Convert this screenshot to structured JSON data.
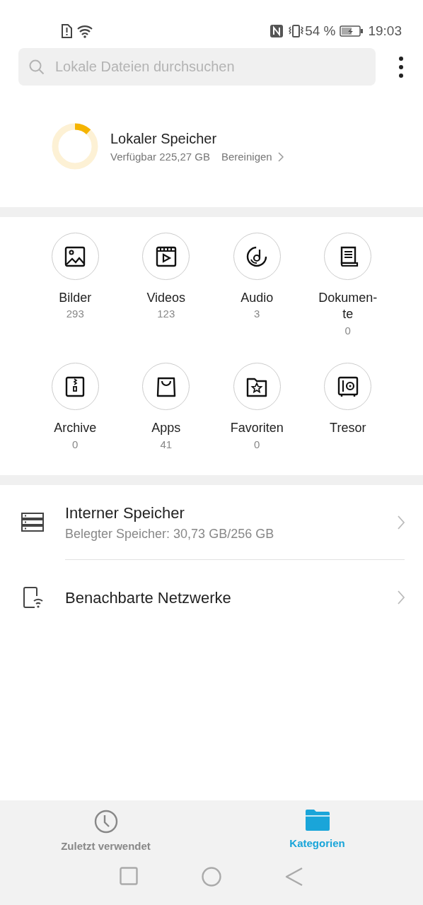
{
  "status_bar": {
    "battery": "54 %",
    "time": "19:03"
  },
  "search": {
    "placeholder": "Lokale Dateien durchsuchen"
  },
  "storage": {
    "title": "Lokaler Speicher",
    "available": "Verfügbar 225,27 GB",
    "action": "Bereinigen",
    "level": 0.12
  },
  "categories": [
    {
      "label": "Bilder",
      "count": "293"
    },
    {
      "label": "Videos",
      "count": "123"
    },
    {
      "label": "Audio",
      "count": "3"
    },
    {
      "label": "Dokumen-te",
      "count": "0"
    },
    {
      "label": "Archive",
      "count": "0"
    },
    {
      "label": "Apps",
      "count": "41"
    },
    {
      "label": "Favoriten",
      "count": "0"
    },
    {
      "label": "Tresor"
    }
  ],
  "locations": [
    {
      "title": "Interner Speicher",
      "subtitle": "Belegter Speicher: 30,73 GB/256 GB"
    },
    {
      "title": "Benachbarte Netzwerke"
    }
  ],
  "bottom_tabs": [
    {
      "label": "Zuletzt verwendet",
      "selected": false
    },
    {
      "label": "Kategorien",
      "selected": true
    }
  ]
}
